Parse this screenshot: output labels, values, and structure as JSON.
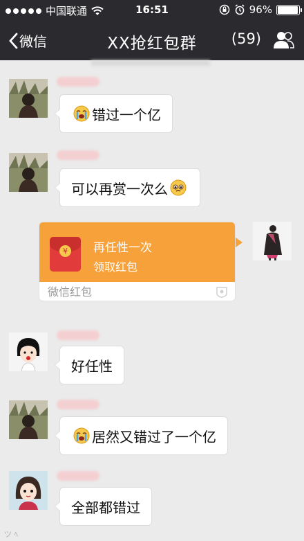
{
  "status_bar": {
    "carrier": "中国联通",
    "time": "16:51",
    "battery": "96%",
    "battery_level": 0.96
  },
  "nav": {
    "back_label": "微信",
    "title": "XX抢红包群",
    "member_count": "(59)"
  },
  "messages": [
    {
      "text": "错过一个亿",
      "emoji": "crying-face-icon"
    },
    {
      "text": "可以再赏一次么",
      "emoji": "pleading-face-icon"
    },
    {
      "text": "好任性"
    },
    {
      "text": "居然又错过了一个亿",
      "emoji": "crying-face-icon"
    },
    {
      "text": "全部都错过"
    }
  ],
  "red_packet": {
    "title": "再任性一次",
    "subtitle": "领取红包",
    "footer": "微信红包",
    "coin_symbol": "¥"
  },
  "colors": {
    "bar": "#2b2b2f",
    "background": "#ebebeb",
    "packet_orange": "#f7a13a",
    "packet_red": "#e23b3b"
  }
}
